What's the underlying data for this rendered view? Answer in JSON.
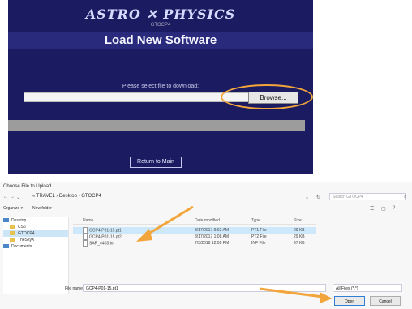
{
  "app": {
    "logo": "ASTRO ✕ PHYSICS",
    "logo_sub": "GTOCP4",
    "page_title": "Load New Software",
    "prompt": "Please select file to download:",
    "browse_label": "Browse...",
    "return_label": "Return to Main"
  },
  "dialog": {
    "title": "Choose File to Upload",
    "breadcrumb": "« TRAVEL › Desktop › GTOCP4",
    "search_placeholder": "Search GTOCP4",
    "organize_label": "Organize ▾",
    "new_folder_label": "New folder",
    "sidebar": [
      {
        "label": "Desktop",
        "icon": "desktop-folder-icon",
        "active": false
      },
      {
        "label": "CS6",
        "icon": "folder-icon",
        "active": false
      },
      {
        "label": "GTOCP4",
        "icon": "folder-icon",
        "active": true
      },
      {
        "label": "TheSkyX",
        "icon": "folder-icon",
        "active": false
      },
      {
        "label": "Documents",
        "icon": "documents-icon",
        "active": false
      }
    ],
    "columns": {
      "name": "Name",
      "date": "Date modified",
      "type": "Type",
      "size": "Size"
    },
    "files": [
      {
        "name": "GCP4-P01-15.pt1",
        "date": "8/17/2017 9:02 AM",
        "type": "PT1 File",
        "size": "29 KB",
        "selected": true
      },
      {
        "name": "GCP4-P01-15.pt2",
        "date": "8/17/2017 1:08 AM",
        "type": "PT2 File",
        "size": "29 KB",
        "selected": false
      },
      {
        "name": "SAR_4403.inf",
        "date": "7/3/2018 12:08 PM",
        "type": "INF File",
        "size": "97 KB",
        "selected": false
      }
    ],
    "file_name_label": "File name:",
    "file_name_value": "GCP4-P01-15.pt1",
    "file_type_value": "All Files (*.*)",
    "open_label": "Open",
    "cancel_label": "Cancel"
  },
  "colors": {
    "app_bg": "#1b1b61",
    "accent": "#f2a53a",
    "selection": "#cde8fa"
  }
}
